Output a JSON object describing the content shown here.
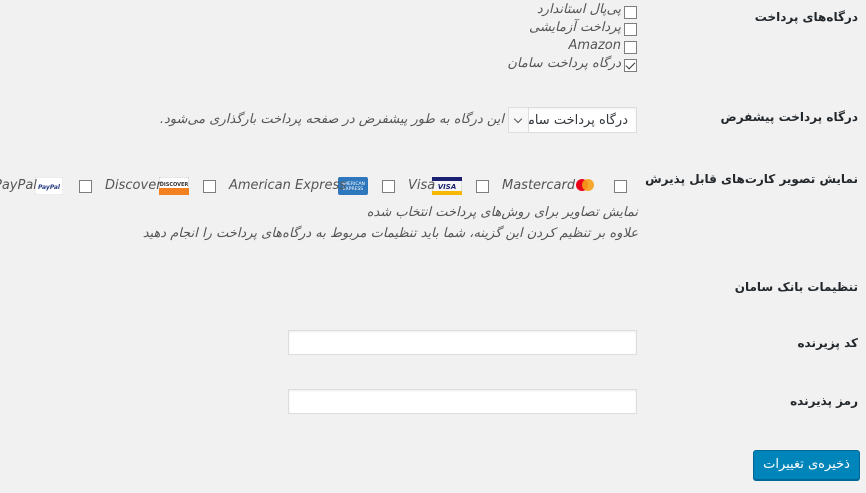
{
  "rows": {
    "gateways_label": "درگاه‌های پرداخت",
    "default_gateway_label": "درگاه پرداخت پیشفرض",
    "card_images_label": "نمایش تصویر کارت‌های قابل پذیرش",
    "saman_settings_label": "تنظیمات بانک سامان",
    "merchant_code_label": "کد پزیرنده",
    "merchant_password_label": "رمز پذیرنده"
  },
  "gateways": [
    {
      "label": "پی‌پال استاندارد",
      "checked": false
    },
    {
      "label": "پرداخت آزمایشی",
      "checked": false
    },
    {
      "label": "Amazon",
      "checked": false
    },
    {
      "label": "درگاه پرداخت سامان",
      "checked": true
    }
  ],
  "default_gateway": {
    "selected": "درگاه پرداخت سامان",
    "description": "این درگاه به طور پیشفرض در صفحه پرداخت بارگذاری می‌شود."
  },
  "cards": [
    {
      "name": "Mastercard",
      "icon": "mastercard-icon",
      "checked": false
    },
    {
      "name": "Visa",
      "icon": "visa-icon",
      "checked": false
    },
    {
      "name": "American Express",
      "icon": "amex-icon",
      "checked": false
    },
    {
      "name": "Discover",
      "icon": "discover-icon",
      "checked": false
    },
    {
      "name": "PayPal",
      "icon": "paypal-icon",
      "checked": false
    }
  ],
  "cards_desc_1": "نمایش تصاویر برای روش‌های پرداخت انتخاب شده",
  "cards_desc_2": "علاوه بر تنظیم کردن این گزینه، شما باید تنظیمات مربوط به درگاه‌های پرداخت را انجام دهید",
  "merchant_code_value": "",
  "merchant_password_value": "",
  "save_button": "ذخیره‌ی تغییرات",
  "colors": {
    "primary_button": "#0085ba",
    "background": "#f1f1f1"
  }
}
